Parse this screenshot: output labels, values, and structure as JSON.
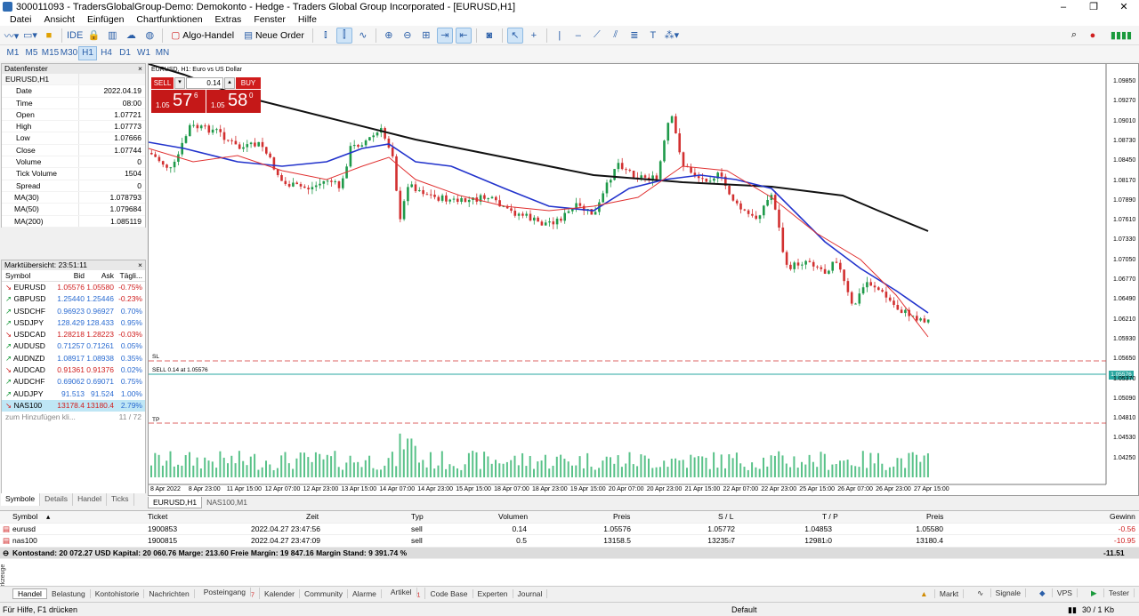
{
  "title": "300011093 - TradersGlobalGroup-Demo: Demokonto - Hedge - Traders Global Group Incorporated - [EURUSD,H1]",
  "window_controls": [
    "–",
    "❐",
    "✕"
  ],
  "menu": [
    "Datei",
    "Ansicht",
    "Einfügen",
    "Chartfunktionen",
    "Extras",
    "Fenster",
    "Hilfe"
  ],
  "toolbar": {
    "algo": "Algo-Handel",
    "new_order": "Neue Order"
  },
  "timeframes": [
    "M1",
    "M5",
    "M15",
    "M30",
    "H1",
    "H4",
    "D1",
    "W1",
    "MN"
  ],
  "active_tf": "H1",
  "datawin": {
    "title": "Datenfenster",
    "symbol": "EURUSD,H1",
    "rows": [
      {
        "k": "Date",
        "v": "2022.04.19"
      },
      {
        "k": "Time",
        "v": "08:00"
      },
      {
        "k": "Open",
        "v": "1.07721"
      },
      {
        "k": "High",
        "v": "1.07773"
      },
      {
        "k": "Low",
        "v": "1.07666"
      },
      {
        "k": "Close",
        "v": "1.07744"
      },
      {
        "k": "Volume",
        "v": "0"
      },
      {
        "k": "Tick Volume",
        "v": "1504"
      },
      {
        "k": "Spread",
        "v": "0"
      },
      {
        "k": "MA(30)",
        "v": "1.078793"
      },
      {
        "k": "MA(50)",
        "v": "1.079684"
      },
      {
        "k": "MA(200)",
        "v": "1.085119"
      }
    ]
  },
  "market": {
    "title": "Marktübersicht: 23:51:11",
    "headers": [
      "Symbol",
      "Bid",
      "Ask",
      "Tägli..."
    ],
    "rows": [
      {
        "s": "EURUSD",
        "bid": "1.05576",
        "ask": "1.05580",
        "chg": "-0.75%",
        "dir": "dn"
      },
      {
        "s": "GBPUSD",
        "bid": "1.25440",
        "ask": "1.25446",
        "chg": "-0.23%",
        "dir": "up"
      },
      {
        "s": "USDCHF",
        "bid": "0.96923",
        "ask": "0.96927",
        "chg": "0.70%",
        "dir": "up"
      },
      {
        "s": "USDJPY",
        "bid": "128.429",
        "ask": "128.433",
        "chg": "0.95%",
        "dir": "up"
      },
      {
        "s": "USDCAD",
        "bid": "1.28218",
        "ask": "1.28223",
        "chg": "-0.03%",
        "dir": "dn"
      },
      {
        "s": "AUDUSD",
        "bid": "0.71257",
        "ask": "0.71261",
        "chg": "0.05%",
        "dir": "up"
      },
      {
        "s": "AUDNZD",
        "bid": "1.08917",
        "ask": "1.08938",
        "chg": "0.35%",
        "dir": "up"
      },
      {
        "s": "AUDCAD",
        "bid": "0.91361",
        "ask": "0.91376",
        "chg": "0.02%",
        "dir": "dn"
      },
      {
        "s": "AUDCHF",
        "bid": "0.69062",
        "ask": "0.69071",
        "chg": "0.75%",
        "dir": "up"
      },
      {
        "s": "AUDJPY",
        "bid": "91.513",
        "ask": "91.524",
        "chg": "1.00%",
        "dir": "up"
      },
      {
        "s": "NAS100",
        "bid": "13178.4",
        "ask": "13180.4",
        "chg": "2.79%",
        "dir": "dn"
      }
    ],
    "add": "zum Hinzufügen kli...",
    "count": "11 / 72"
  },
  "left_tabs": [
    "Symbole",
    "Details",
    "Handel",
    "Ticks"
  ],
  "chart": {
    "label": "EURUSD, H1:  Euro vs US Dollar",
    "sell": "SELL",
    "buy": "BUY",
    "lot": "0.14",
    "sell_pre": "1.05",
    "sell_big": "57",
    "sell_sup": "6",
    "buy_pre": "1.05",
    "buy_big": "58",
    "buy_sup": "0",
    "sl_label": "SL",
    "tp_label": "TP",
    "pos_label": "SELL 0.14 at 1.05576",
    "price_tag": "1.05576",
    "yticks": [
      "1.09850",
      "1.09270",
      "1.09010",
      "1.08730",
      "1.08450",
      "1.08170",
      "1.07890",
      "1.07610",
      "1.07330",
      "1.07050",
      "1.06770",
      "1.06490",
      "1.06210",
      "1.05930",
      "1.05650",
      "1.05370",
      "1.05090",
      "1.04810",
      "1.04530",
      "1.04250"
    ],
    "xticks": [
      "8 Apr 2022",
      "8 Apr 23:00",
      "11 Apr 15:00",
      "12 Apr 07:00",
      "12 Apr 23:00",
      "13 Apr 15:00",
      "14 Apr 07:00",
      "14 Apr 23:00",
      "15 Apr 15:00",
      "18 Apr 07:00",
      "18 Apr 23:00",
      "19 Apr 15:00",
      "20 Apr 07:00",
      "20 Apr 23:00",
      "21 Apr 15:00",
      "22 Apr 07:00",
      "22 Apr 23:00",
      "25 Apr 15:00",
      "26 Apr 07:00",
      "26 Apr 23:00",
      "27 Apr 15:00"
    ],
    "colors": {
      "ma200": "#111111",
      "ma50": "#2233cc",
      "ma30": "#e03030",
      "bull": "#1f9a4a",
      "bear": "#d23030",
      "vol": "#2fb36b",
      "line": "#2aa7a0"
    }
  },
  "chart_tabs": [
    "EURUSD,H1",
    "NAS100,M1"
  ],
  "trade": {
    "headers": [
      "Symbol",
      "Ticket",
      "Zeit",
      "Typ",
      "Volumen",
      "Preis",
      "S / L",
      "T / P",
      "Preis",
      "Gewinn"
    ],
    "rows": [
      [
        "eurusd",
        "1900853",
        "2022.04.27 23:47:56",
        "sell",
        "0.14",
        "1.05576",
        "1.05772",
        "1.04853",
        "1.05580",
        "-0.56"
      ],
      [
        "nas100",
        "1900815",
        "2022.04.27 23:47:09",
        "sell",
        "0.5",
        "13158.5",
        "13235.7",
        "12981.0",
        "13180.4",
        "-10.95"
      ]
    ],
    "summary": "Kontostand: 20 072.27 USD  Kapital: 20 060.76  Marge: 213.60  Freie Margin: 19 847.16  Margin Stand: 9 391.74 %",
    "summary_val": "-11.51"
  },
  "bottom_tabs": [
    "Handel",
    "Belastung",
    "Kontohistorie",
    "Nachrichten",
    "Posteingang",
    "Kalender",
    "Community",
    "Alarme",
    "Artikel",
    "Code Base",
    "Experten",
    "Journal"
  ],
  "bottom_badges": {
    "posteingang": "7",
    "artikel": "1"
  },
  "bottom_right": [
    "Markt",
    "Signale",
    "VPS",
    "Tester"
  ],
  "werkzeuge": "Werkzeuge",
  "status": {
    "left": "Für Hilfe, F1 drücken",
    "mid": "Default",
    "right": "30 / 1 Kb"
  }
}
